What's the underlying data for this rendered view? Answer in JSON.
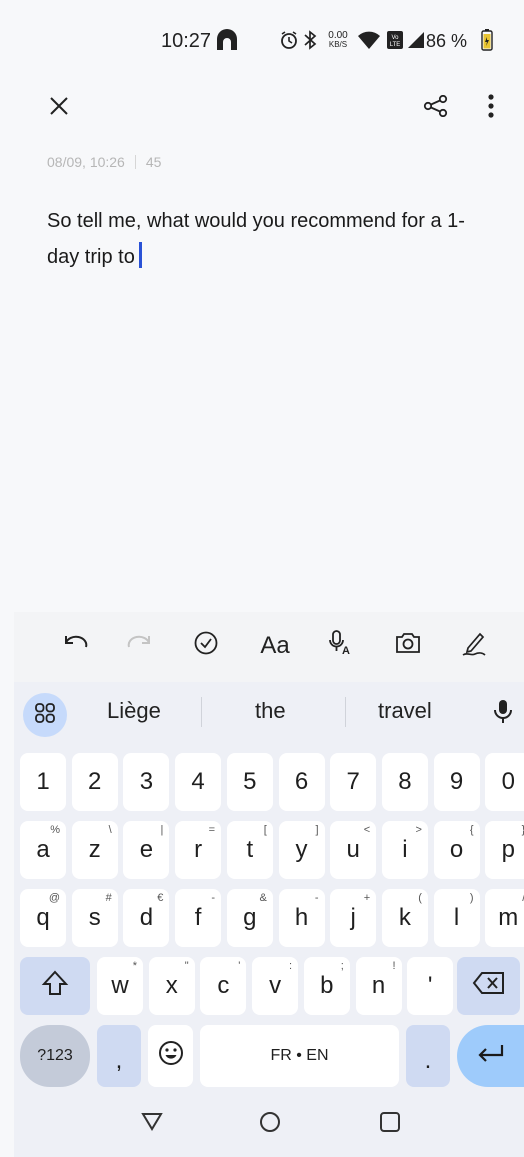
{
  "status": {
    "time": "10:27",
    "net_speed_value": "0.00",
    "net_speed_unit": "KB/S",
    "battery": "86 %"
  },
  "note": {
    "date": "08/09, 10:26",
    "char_count": "45",
    "text": "So tell me, what would you recommend for a 1-day trip to"
  },
  "keyboard": {
    "suggestions": [
      "Liège",
      "the",
      "travel"
    ],
    "row1": [
      {
        "k": "1"
      },
      {
        "k": "2"
      },
      {
        "k": "3"
      },
      {
        "k": "4"
      },
      {
        "k": "5"
      },
      {
        "k": "6"
      },
      {
        "k": "7"
      },
      {
        "k": "8"
      },
      {
        "k": "9"
      },
      {
        "k": "0"
      }
    ],
    "row2": [
      {
        "k": "a",
        "h": "%"
      },
      {
        "k": "z",
        "h": "\\"
      },
      {
        "k": "e",
        "h": "|"
      },
      {
        "k": "r",
        "h": "="
      },
      {
        "k": "t",
        "h": "["
      },
      {
        "k": "y",
        "h": "]"
      },
      {
        "k": "u",
        "h": "<"
      },
      {
        "k": "i",
        "h": ">"
      },
      {
        "k": "o",
        "h": "{"
      },
      {
        "k": "p",
        "h": "}"
      }
    ],
    "row3": [
      {
        "k": "q",
        "h": "@"
      },
      {
        "k": "s",
        "h": "#"
      },
      {
        "k": "d",
        "h": "€"
      },
      {
        "k": "f",
        "h": "-"
      },
      {
        "k": "g",
        "h": "&"
      },
      {
        "k": "h",
        "h": "-"
      },
      {
        "k": "j",
        "h": "+"
      },
      {
        "k": "k",
        "h": "("
      },
      {
        "k": "l",
        "h": ")"
      },
      {
        "k": "m",
        "h": "/"
      }
    ],
    "row4": [
      {
        "k": "w",
        "h": "*"
      },
      {
        "k": "x",
        "h": "\""
      },
      {
        "k": "c",
        "h": "'"
      },
      {
        "k": "v",
        "h": ":"
      },
      {
        "k": "b",
        "h": ";"
      },
      {
        "k": "n",
        "h": "!"
      },
      {
        "k": "'",
        "h": ""
      }
    ],
    "symbols_label": "?123",
    "comma": ",",
    "space_label": "FR • EN",
    "period": "."
  },
  "icons": {
    "close": "close-icon",
    "share": "share-icon",
    "more": "more-vert-icon",
    "undo": "undo-icon",
    "redo": "redo-icon",
    "checklist": "check-circle-icon",
    "text_format": "text-format-icon",
    "voice": "voice-text-icon",
    "camera": "camera-icon",
    "draw": "pen-icon",
    "shift": "shift-icon",
    "backspace": "backspace-icon",
    "emoji": "emoji-icon",
    "enter": "enter-icon",
    "apps": "keyboard-menu-icon",
    "mic": "mic-icon",
    "nav_back": "nav-back-icon",
    "nav_home": "nav-home-icon",
    "nav_recents": "nav-recents-icon"
  },
  "toolbar": {
    "text_format_label": "Aa"
  },
  "colors": {
    "cursor": "#2a52d6",
    "enter_key": "#9ecbfb",
    "shift_key": "#cfdaf2",
    "suggest_menu": "#c6dafb"
  }
}
